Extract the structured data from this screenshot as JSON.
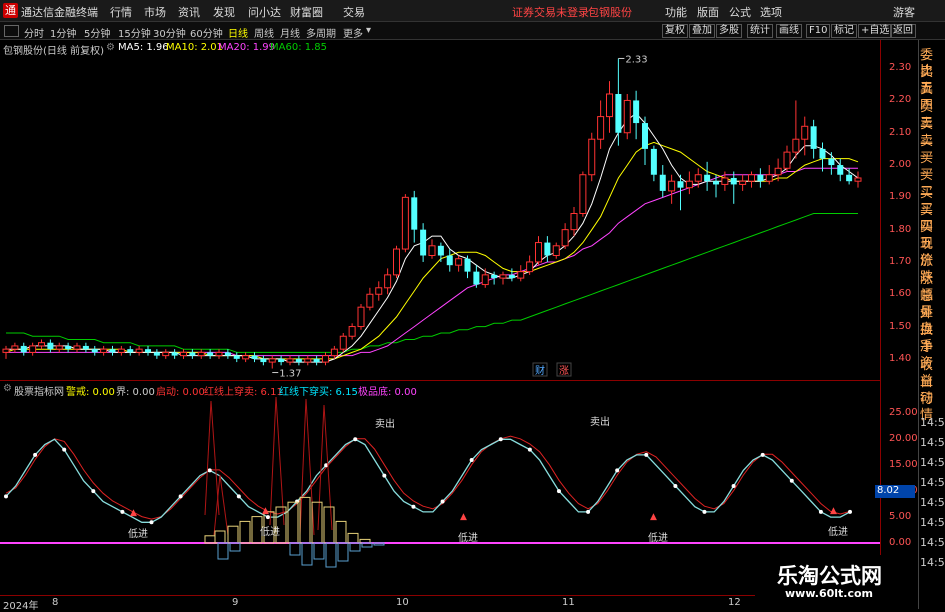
{
  "app": {
    "logo_glyph": "通",
    "name": "通达信金融终端",
    "menu": [
      "行情",
      "市场",
      "资讯",
      "发现",
      "问小达",
      "财富圈",
      "交易"
    ],
    "login_notice": "证券交易未登录",
    "stock_name_top": "包钢股份",
    "right_menu": [
      "功能",
      "版面",
      "公式",
      "选项"
    ],
    "guest": "游客"
  },
  "toolbar": {
    "periods": [
      "分时",
      "1分钟",
      "5分钟",
      "15分钟",
      "30分钟",
      "60分钟",
      "日线",
      "周线",
      "月线",
      "多周期",
      "更多"
    ],
    "active": "日线",
    "right_buttons": [
      "复权",
      "叠加",
      "多股",
      "统计",
      "画线",
      "F10",
      "标记",
      "+自选",
      "返回"
    ]
  },
  "info": {
    "title": "包钢股份(日线 前复权)",
    "ma5": "MA5: 1.96",
    "ma10": "MA10: 2.01",
    "ma20": "MA20: 1.99",
    "ma60": "MA60: 1.85",
    "colors": {
      "ma5": "#ffffff",
      "ma10": "#ffff00",
      "ma20": "#ff44ff",
      "ma60": "#00cc00"
    }
  },
  "indicator": {
    "name": "股票指标网",
    "f1": "警戒: 0.00",
    "f2": "界: 0.00",
    "f3": "启动: 0.00",
    "f4": "红线上穿卖: 6.11",
    "f5": "红线下穿买: 6.15",
    "f6": "极品底: 0.00"
  },
  "price_axis": [
    "2.30",
    "2.20",
    "2.10",
    "2.00",
    "1.90",
    "1.80",
    "1.70",
    "1.60",
    "1.50",
    "1.40"
  ],
  "ind_axis": [
    "25.00",
    "20.00",
    "15.00",
    "10.00",
    "5.00",
    "0.00"
  ],
  "ind_value_box": "8.02",
  "annotations": {
    "high": "2.33",
    "low": "1.37",
    "cai": "财",
    "zhang": "涨",
    "sell_label": "卖出",
    "buy_label": "低进"
  },
  "dates": [
    "2024年",
    "8",
    "9",
    "10",
    "11",
    "12"
  ],
  "side_panel": [
    "委比",
    "卖五",
    "卖四",
    "卖三",
    "卖二",
    "卖一",
    "买一",
    "买二",
    "买三",
    "买四",
    "买五",
    "现价",
    "涨跌",
    "涨幅",
    "总量",
    "外盘",
    "换手",
    "净资",
    "收益",
    "自动",
    "行情"
  ],
  "side_time": [
    "14:5",
    "14:5",
    "14:5",
    "14:5",
    "14:5",
    "14:5",
    "14:5",
    "14:5"
  ],
  "watermark": {
    "title": "乐淘公式网",
    "url": "www.60lt.com"
  },
  "chart_data": {
    "type": "candlestick",
    "ylim": [
      1.35,
      2.35
    ],
    "candles": [
      [
        1.42,
        1.43,
        1.4,
        1.44
      ],
      [
        1.43,
        1.44,
        1.42,
        1.45
      ],
      [
        1.44,
        1.42,
        1.41,
        1.45
      ],
      [
        1.42,
        1.44,
        1.41,
        1.45
      ],
      [
        1.44,
        1.45,
        1.43,
        1.46
      ],
      [
        1.45,
        1.43,
        1.42,
        1.46
      ],
      [
        1.43,
        1.44,
        1.42,
        1.45
      ],
      [
        1.44,
        1.43,
        1.42,
        1.45
      ],
      [
        1.43,
        1.44,
        1.42,
        1.45
      ],
      [
        1.44,
        1.43,
        1.42,
        1.45
      ],
      [
        1.43,
        1.42,
        1.41,
        1.44
      ],
      [
        1.42,
        1.43,
        1.41,
        1.44
      ],
      [
        1.43,
        1.42,
        1.41,
        1.44
      ],
      [
        1.42,
        1.43,
        1.41,
        1.44
      ],
      [
        1.43,
        1.42,
        1.41,
        1.44
      ],
      [
        1.42,
        1.43,
        1.41,
        1.44
      ],
      [
        1.43,
        1.42,
        1.41,
        1.44
      ],
      [
        1.42,
        1.41,
        1.4,
        1.43
      ],
      [
        1.41,
        1.42,
        1.4,
        1.43
      ],
      [
        1.42,
        1.41,
        1.4,
        1.43
      ],
      [
        1.41,
        1.42,
        1.4,
        1.43
      ],
      [
        1.42,
        1.41,
        1.4,
        1.43
      ],
      [
        1.41,
        1.42,
        1.4,
        1.43
      ],
      [
        1.42,
        1.41,
        1.4,
        1.43
      ],
      [
        1.41,
        1.42,
        1.4,
        1.43
      ],
      [
        1.42,
        1.41,
        1.4,
        1.43
      ],
      [
        1.41,
        1.4,
        1.39,
        1.42
      ],
      [
        1.4,
        1.41,
        1.39,
        1.42
      ],
      [
        1.41,
        1.4,
        1.39,
        1.42
      ],
      [
        1.4,
        1.39,
        1.38,
        1.41
      ],
      [
        1.39,
        1.4,
        1.37,
        1.41
      ],
      [
        1.4,
        1.39,
        1.38,
        1.41
      ],
      [
        1.39,
        1.4,
        1.38,
        1.41
      ],
      [
        1.4,
        1.39,
        1.38,
        1.41
      ],
      [
        1.39,
        1.4,
        1.38,
        1.41
      ],
      [
        1.4,
        1.39,
        1.38,
        1.41
      ],
      [
        1.39,
        1.41,
        1.38,
        1.42
      ],
      [
        1.41,
        1.43,
        1.4,
        1.44
      ],
      [
        1.43,
        1.47,
        1.42,
        1.48
      ],
      [
        1.47,
        1.5,
        1.46,
        1.51
      ],
      [
        1.5,
        1.56,
        1.49,
        1.57
      ],
      [
        1.56,
        1.6,
        1.55,
        1.62
      ],
      [
        1.6,
        1.62,
        1.58,
        1.64
      ],
      [
        1.62,
        1.66,
        1.6,
        1.68
      ],
      [
        1.66,
        1.74,
        1.65,
        1.75
      ],
      [
        1.74,
        1.9,
        1.73,
        1.91
      ],
      [
        1.9,
        1.8,
        1.76,
        1.92
      ],
      [
        1.8,
        1.72,
        1.7,
        1.82
      ],
      [
        1.72,
        1.75,
        1.71,
        1.77
      ],
      [
        1.75,
        1.72,
        1.7,
        1.76
      ],
      [
        1.72,
        1.69,
        1.67,
        1.74
      ],
      [
        1.69,
        1.71,
        1.67,
        1.72
      ],
      [
        1.71,
        1.67,
        1.65,
        1.72
      ],
      [
        1.67,
        1.63,
        1.62,
        1.69
      ],
      [
        1.63,
        1.66,
        1.62,
        1.68
      ],
      [
        1.66,
        1.65,
        1.63,
        1.67
      ],
      [
        1.65,
        1.66,
        1.63,
        1.67
      ],
      [
        1.66,
        1.65,
        1.64,
        1.68
      ],
      [
        1.65,
        1.67,
        1.64,
        1.69
      ],
      [
        1.67,
        1.7,
        1.66,
        1.72
      ],
      [
        1.7,
        1.76,
        1.69,
        1.78
      ],
      [
        1.76,
        1.72,
        1.7,
        1.78
      ],
      [
        1.72,
        1.75,
        1.71,
        1.76
      ],
      [
        1.75,
        1.8,
        1.74,
        1.82
      ],
      [
        1.8,
        1.85,
        1.78,
        1.87
      ],
      [
        1.85,
        1.97,
        1.84,
        1.98
      ],
      [
        1.97,
        2.08,
        1.95,
        2.1
      ],
      [
        2.08,
        2.15,
        2.05,
        2.2
      ],
      [
        2.15,
        2.22,
        2.1,
        2.26
      ],
      [
        2.22,
        2.1,
        2.06,
        2.33
      ],
      [
        2.1,
        2.2,
        2.08,
        2.22
      ],
      [
        2.2,
        2.13,
        2.08,
        2.23
      ],
      [
        2.13,
        2.05,
        2.0,
        2.15
      ],
      [
        2.05,
        1.97,
        1.95,
        2.06
      ],
      [
        1.97,
        1.92,
        1.9,
        2.0
      ],
      [
        1.92,
        1.95,
        1.88,
        1.97
      ],
      [
        1.95,
        1.93,
        1.86,
        1.97
      ],
      [
        1.93,
        1.95,
        1.91,
        1.98
      ],
      [
        1.95,
        1.97,
        1.93,
        1.99
      ],
      [
        1.97,
        1.95,
        1.92,
        2.01
      ],
      [
        1.95,
        1.94,
        1.9,
        1.97
      ],
      [
        1.94,
        1.96,
        1.92,
        1.98
      ],
      [
        1.96,
        1.94,
        1.88,
        1.98
      ],
      [
        1.94,
        1.95,
        1.92,
        1.97
      ],
      [
        1.95,
        1.97,
        1.93,
        1.98
      ],
      [
        1.97,
        1.95,
        1.93,
        1.99
      ],
      [
        1.95,
        1.97,
        1.94,
        2.0
      ],
      [
        1.97,
        1.99,
        1.95,
        2.02
      ],
      [
        1.99,
        2.04,
        1.98,
        2.06
      ],
      [
        2.04,
        2.08,
        2.02,
        2.2
      ],
      [
        2.08,
        2.12,
        2.03,
        2.15
      ],
      [
        2.12,
        2.05,
        2.02,
        2.14
      ],
      [
        2.05,
        2.02,
        1.98,
        2.07
      ],
      [
        2.02,
        2.0,
        1.97,
        2.04
      ],
      [
        2.0,
        1.97,
        1.95,
        2.02
      ],
      [
        1.97,
        1.95,
        1.94,
        1.99
      ],
      [
        1.95,
        1.96,
        1.93,
        1.98
      ]
    ],
    "ma5": [
      1.43,
      1.43,
      1.43,
      1.44,
      1.44,
      1.44,
      1.44,
      1.44,
      1.43,
      1.43,
      1.43,
      1.43,
      1.42,
      1.42,
      1.42,
      1.42,
      1.42,
      1.42,
      1.42,
      1.42,
      1.41,
      1.41,
      1.41,
      1.41,
      1.41,
      1.41,
      1.41,
      1.41,
      1.4,
      1.4,
      1.4,
      1.4,
      1.39,
      1.39,
      1.39,
      1.39,
      1.39,
      1.4,
      1.42,
      1.44,
      1.47,
      1.51,
      1.55,
      1.59,
      1.64,
      1.71,
      1.75,
      1.76,
      1.78,
      1.78,
      1.74,
      1.72,
      1.71,
      1.69,
      1.67,
      1.66,
      1.65,
      1.65,
      1.66,
      1.67,
      1.7,
      1.72,
      1.73,
      1.75,
      1.78,
      1.82,
      1.88,
      1.96,
      2.05,
      2.1,
      2.14,
      2.16,
      2.13,
      2.09,
      2.05,
      2.0,
      1.96,
      1.94,
      1.94,
      1.95,
      1.95,
      1.95,
      1.95,
      1.95,
      1.95,
      1.95,
      1.96,
      1.97,
      1.99,
      2.03,
      2.06,
      2.06,
      2.05,
      2.03,
      2.0,
      1.98,
      1.96
    ],
    "ma10": [
      1.42,
      1.43,
      1.43,
      1.43,
      1.43,
      1.43,
      1.43,
      1.43,
      1.43,
      1.43,
      1.43,
      1.43,
      1.43,
      1.43,
      1.42,
      1.42,
      1.42,
      1.42,
      1.42,
      1.42,
      1.42,
      1.42,
      1.42,
      1.41,
      1.41,
      1.41,
      1.41,
      1.41,
      1.41,
      1.4,
      1.4,
      1.4,
      1.4,
      1.4,
      1.4,
      1.4,
      1.4,
      1.4,
      1.41,
      1.42,
      1.43,
      1.45,
      1.47,
      1.5,
      1.53,
      1.57,
      1.61,
      1.65,
      1.68,
      1.71,
      1.72,
      1.73,
      1.73,
      1.73,
      1.72,
      1.7,
      1.68,
      1.67,
      1.67,
      1.67,
      1.68,
      1.69,
      1.7,
      1.71,
      1.73,
      1.76,
      1.8,
      1.84,
      1.9,
      1.96,
      2.0,
      2.04,
      2.06,
      2.07,
      2.06,
      2.05,
      2.04,
      2.02,
      2.0,
      1.98,
      1.97,
      1.96,
      1.95,
      1.95,
      1.95,
      1.95,
      1.95,
      1.96,
      1.96,
      1.98,
      2.0,
      2.01,
      2.02,
      2.02,
      2.02,
      2.02,
      2.01
    ],
    "ma20": [
      1.42,
      1.42,
      1.42,
      1.42,
      1.42,
      1.42,
      1.42,
      1.42,
      1.42,
      1.42,
      1.42,
      1.42,
      1.42,
      1.42,
      1.42,
      1.42,
      1.42,
      1.42,
      1.42,
      1.42,
      1.42,
      1.42,
      1.42,
      1.42,
      1.42,
      1.42,
      1.41,
      1.41,
      1.41,
      1.41,
      1.41,
      1.41,
      1.41,
      1.41,
      1.41,
      1.41,
      1.41,
      1.41,
      1.41,
      1.41,
      1.42,
      1.42,
      1.43,
      1.44,
      1.46,
      1.48,
      1.5,
      1.52,
      1.54,
      1.56,
      1.58,
      1.6,
      1.62,
      1.63,
      1.64,
      1.65,
      1.66,
      1.66,
      1.67,
      1.68,
      1.69,
      1.7,
      1.7,
      1.71,
      1.72,
      1.74,
      1.75,
      1.77,
      1.79,
      1.82,
      1.84,
      1.86,
      1.88,
      1.89,
      1.9,
      1.91,
      1.92,
      1.93,
      1.94,
      1.95,
      1.96,
      1.97,
      1.97,
      1.97,
      1.97,
      1.97,
      1.97,
      1.97,
      1.98,
      1.98,
      1.99,
      1.99,
      1.99,
      1.99,
      1.99,
      1.99,
      1.99
    ],
    "ma60": [
      1.48,
      1.48,
      1.48,
      1.47,
      1.47,
      1.47,
      1.47,
      1.46,
      1.46,
      1.46,
      1.46,
      1.45,
      1.45,
      1.45,
      1.45,
      1.44,
      1.44,
      1.44,
      1.44,
      1.44,
      1.43,
      1.43,
      1.43,
      1.43,
      1.43,
      1.43,
      1.42,
      1.42,
      1.42,
      1.42,
      1.42,
      1.42,
      1.42,
      1.42,
      1.42,
      1.42,
      1.42,
      1.42,
      1.42,
      1.43,
      1.43,
      1.44,
      1.44,
      1.45,
      1.45,
      1.46,
      1.46,
      1.47,
      1.47,
      1.48,
      1.48,
      1.49,
      1.49,
      1.5,
      1.5,
      1.51,
      1.51,
      1.52,
      1.52,
      1.53,
      1.54,
      1.55,
      1.56,
      1.57,
      1.58,
      1.59,
      1.6,
      1.61,
      1.62,
      1.63,
      1.64,
      1.65,
      1.66,
      1.67,
      1.68,
      1.69,
      1.7,
      1.71,
      1.72,
      1.73,
      1.74,
      1.75,
      1.76,
      1.77,
      1.78,
      1.79,
      1.8,
      1.81,
      1.82,
      1.83,
      1.84,
      1.85,
      1.85,
      1.85,
      1.85,
      1.85,
      1.85
    ],
    "ind_ylim": [
      0,
      27
    ],
    "ind_line": [
      9,
      11,
      14,
      17,
      19,
      20,
      18,
      15,
      12,
      10,
      8,
      7,
      6,
      5,
      4,
      4,
      5,
      7,
      9,
      11,
      13,
      14,
      13,
      11,
      9,
      7,
      6,
      5,
      5,
      6,
      8,
      10,
      13,
      15,
      17,
      19,
      20,
      19,
      16,
      13,
      10,
      8,
      7,
      6,
      6,
      8,
      10,
      13,
      16,
      18,
      19,
      20,
      20,
      19,
      18,
      16,
      13,
      10,
      8,
      6,
      6,
      8,
      11,
      14,
      16,
      17,
      17,
      15,
      13,
      11,
      9,
      7,
      6,
      6,
      8,
      11,
      14,
      16,
      17,
      16,
      14,
      12,
      10,
      8,
      6,
      5,
      5,
      6
    ]
  }
}
